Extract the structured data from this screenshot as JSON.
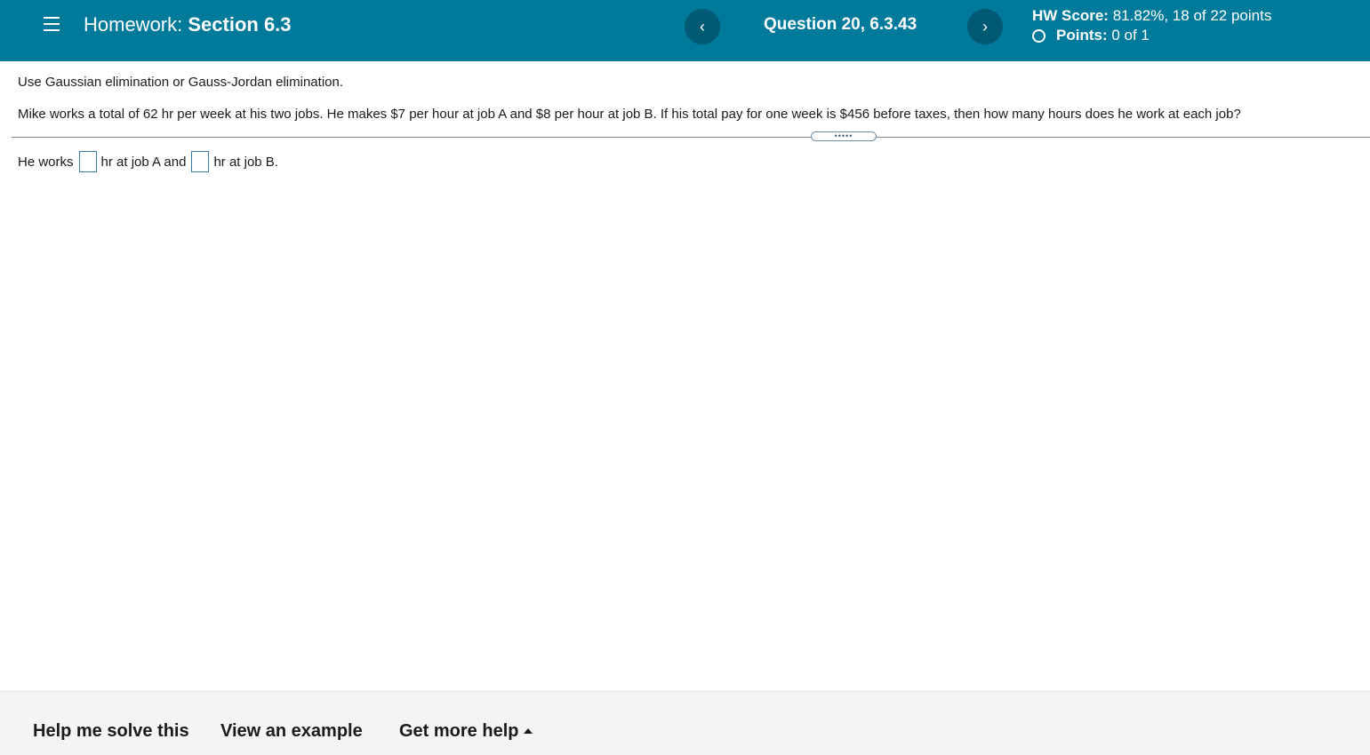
{
  "header": {
    "hw_prefix": "Homework:",
    "hw_section": "Section 6.3",
    "question": "Question 20, 6.3.43",
    "prev_glyph": "‹",
    "next_glyph": "›",
    "score_label": "HW Score:",
    "score_value": "81.82%, 18 of 22 points",
    "points_label": "Points:",
    "points_value": "0 of 1"
  },
  "question_body": {
    "instruction": "Use Gaussian elimination or Gauss-Jordan elimination.",
    "problem": "Mike works a total of 62 hr per week at his two jobs. He makes $7 per hour at job A and $8 per hour at job B. If his total pay for one week is $456 before taxes, then how many hours does he work at each job?",
    "expand_dots": "•••••",
    "answer_prefix": "He works",
    "answer_middle": "hr at job A and",
    "answer_suffix": "hr at job B.",
    "answer_a_value": "",
    "answer_b_value": ""
  },
  "footer": {
    "help_solve": "Help me solve this",
    "view_example": "View an example",
    "more_help": "Get more help"
  },
  "colors": {
    "header_bg": "#007a9b",
    "nav_button_bg": "#005a74",
    "footer_bg": "#f4f4f4"
  },
  "icons": {
    "menu": "hamburger-menu-icon",
    "prev": "chevron-left-icon",
    "next": "chevron-right-icon",
    "status": "empty-circle-icon",
    "dropdown": "caret-up-icon"
  }
}
